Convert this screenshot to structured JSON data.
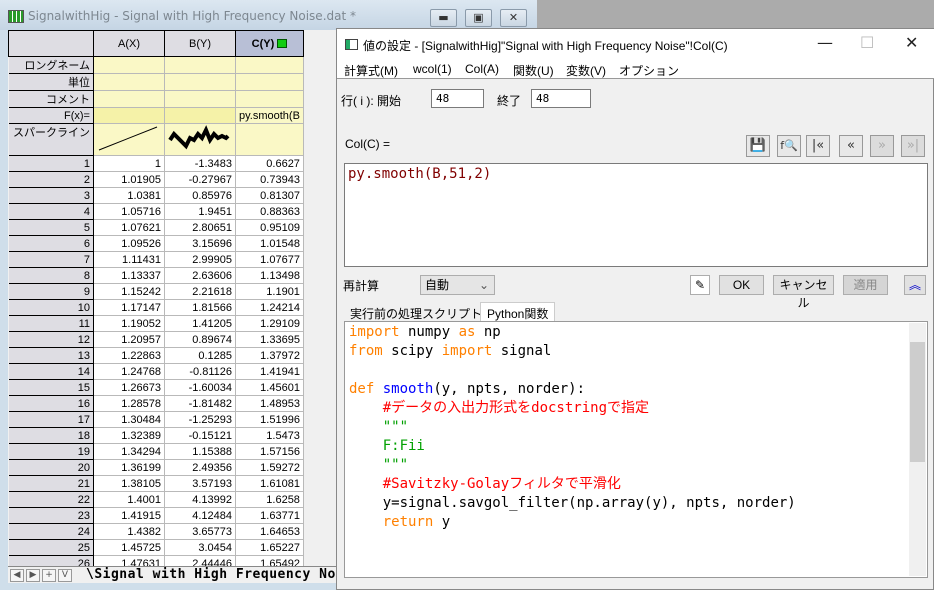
{
  "worksheet": {
    "title": "SignalwithHig - Signal with High Frequency Noise.dat *",
    "columns": [
      "A(X)",
      "B(Y)",
      "C(Y)"
    ],
    "label_rows": [
      "ロングネーム",
      "単位",
      "コメント",
      "F(x)=",
      "スパークライン"
    ],
    "formula_c": "py.smooth(B",
    "rows": [
      [
        "1",
        "1",
        "-1.3483",
        "0.6627"
      ],
      [
        "2",
        "1.01905",
        "-0.27967",
        "0.73943"
      ],
      [
        "3",
        "1.0381",
        "0.85976",
        "0.81307"
      ],
      [
        "4",
        "1.05716",
        "1.9451",
        "0.88363"
      ],
      [
        "5",
        "1.07621",
        "2.80651",
        "0.95109"
      ],
      [
        "6",
        "1.09526",
        "3.15696",
        "1.01548"
      ],
      [
        "7",
        "1.11431",
        "2.99905",
        "1.07677"
      ],
      [
        "8",
        "1.13337",
        "2.63606",
        "1.13498"
      ],
      [
        "9",
        "1.15242",
        "2.21618",
        "1.1901"
      ],
      [
        "10",
        "1.17147",
        "1.81566",
        "1.24214"
      ],
      [
        "11",
        "1.19052",
        "1.41205",
        "1.29109"
      ],
      [
        "12",
        "1.20957",
        "0.89674",
        "1.33695"
      ],
      [
        "13",
        "1.22863",
        "0.1285",
        "1.37972"
      ],
      [
        "14",
        "1.24768",
        "-0.81126",
        "1.41941"
      ],
      [
        "15",
        "1.26673",
        "-1.60034",
        "1.45601"
      ],
      [
        "16",
        "1.28578",
        "-1.81482",
        "1.48953"
      ],
      [
        "17",
        "1.30484",
        "-1.25293",
        "1.51996"
      ],
      [
        "18",
        "1.32389",
        "-0.15121",
        "1.5473"
      ],
      [
        "19",
        "1.34294",
        "1.15388",
        "1.57156"
      ],
      [
        "20",
        "1.36199",
        "2.49356",
        "1.59272"
      ],
      [
        "21",
        "1.38105",
        "3.57193",
        "1.61081"
      ],
      [
        "22",
        "1.4001",
        "4.13992",
        "1.6258"
      ],
      [
        "23",
        "1.41915",
        "4.12484",
        "1.63771"
      ],
      [
        "24",
        "1.4382",
        "3.65773",
        "1.64653"
      ],
      [
        "25",
        "1.45725",
        "3.0454",
        "1.65227"
      ],
      [
        "26",
        "1.47631",
        "2.44446",
        "1.65492"
      ]
    ],
    "sheet_tab": "Signal with High Frequency Noise",
    "nav": [
      "◀",
      "▶",
      "+",
      "V"
    ]
  },
  "dialog": {
    "title": "値の設定 - [SignalwithHig]\"Signal with High Frequency Noise\"!Col(C)",
    "menu": [
      "計算式(M)",
      "wcol(1)",
      "Col(A)",
      "関数(U)",
      "変数(V)",
      "オプション"
    ],
    "row_label": "行( i ): 開始",
    "start": "48",
    "end_label": "終了",
    "end": "48",
    "col_label": "Col(C) =",
    "formula": "py.smooth(B,51,2)",
    "recalc_label": "再計算",
    "recalc_value": "自動",
    "ok": "OK",
    "cancel": "キャンセル",
    "apply": "適用",
    "tabs": [
      "実行前の処理スクリプト",
      "Python関数"
    ],
    "active_tab": "Python関数"
  },
  "code": {
    "l1": [
      "import",
      " numpy ",
      "as",
      " np"
    ],
    "l2": [
      "from",
      " scipy ",
      "import",
      " signal"
    ],
    "l4": [
      "def",
      " ",
      "smooth",
      "(y, npts, norder):"
    ],
    "l5": "#データの入出力形式をdocstringで指定",
    "l6": "\"\"\"",
    "l7": "F:Fii",
    "l8": "\"\"\"",
    "l9": "#Savitzky-Golayフィルタで平滑化",
    "l10": "y=signal.savgol_filter(np.array(y), npts, norder)",
    "l11": [
      "return",
      " y"
    ]
  }
}
